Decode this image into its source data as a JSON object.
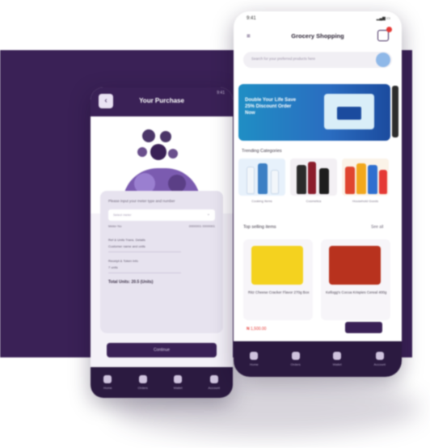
{
  "left_phone": {
    "title": "Your Purchase",
    "status": "9:41",
    "form": {
      "prompt": "Please input your meter type and number",
      "select_placeholder": "Select meter",
      "meter_label": "Meter No",
      "meter_value": "0000001 0000001",
      "details": [
        "Ref & Units Trans. Details",
        "Customer name and units",
        "Receipt & Token Info",
        "7 units"
      ],
      "amount": "Total Units: 20.5 (Units)"
    },
    "pay_label": "Continue",
    "tabs": [
      "Home",
      "Orders",
      "Wallet",
      "Account"
    ]
  },
  "right_phone": {
    "time": "9:41",
    "signal": "▂▄▆ ▭",
    "title": "Grocery Shopping",
    "search_placeholder": "Search for your preferred products here",
    "banner_text": "Double Your Life Save 25% Discount Order Now",
    "categories_title": "Trending Categories",
    "categories": [
      "Cooking Items",
      "Cosmetics",
      "Household Goods"
    ],
    "best_sellers_title": "Top selling items",
    "see_all": "See all",
    "products": [
      "Ritz Cheese Cracker Flavor 270g Box",
      "Kellogg's Cocoa Krispies Cereal 400g"
    ],
    "price": "₦ 1,500.00",
    "tabs": [
      "Home",
      "Orders",
      "Wallet",
      "Account"
    ]
  },
  "colors": {
    "brand": "#3a2156",
    "accent": "#e53935",
    "banner": "#1f8ec4"
  }
}
